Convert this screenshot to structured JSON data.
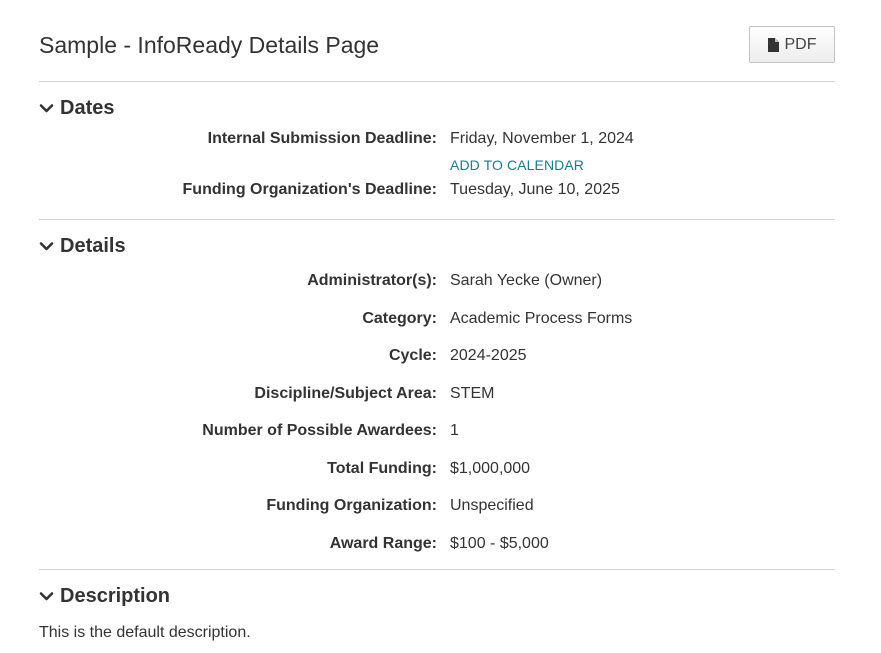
{
  "page": {
    "title": "Sample - InfoReady Details Page",
    "pdf_label": "PDF"
  },
  "dates": {
    "heading": "Dates",
    "internal_deadline_label": "Internal Submission Deadline:",
    "internal_deadline_value": "Friday, November 1, 2024",
    "add_to_calendar": "ADD TO CALENDAR",
    "funding_deadline_label": "Funding Organization's Deadline:",
    "funding_deadline_value": "Tuesday, June 10, 2025"
  },
  "details": {
    "heading": "Details",
    "rows": [
      {
        "label": "Administrator(s):",
        "value": "Sarah Yecke (Owner)"
      },
      {
        "label": "Category:",
        "value": "Academic Process Forms"
      },
      {
        "label": "Cycle:",
        "value": "2024-2025"
      },
      {
        "label": "Discipline/Subject Area:",
        "value": "STEM"
      },
      {
        "label": "Number of Possible Awardees:",
        "value": "1"
      },
      {
        "label": "Total Funding:",
        "value": "$1,000,000"
      },
      {
        "label": "Funding Organization:",
        "value": "Unspecified"
      },
      {
        "label": "Award Range:",
        "value": "$100 - $5,000"
      }
    ]
  },
  "description": {
    "heading": "Description",
    "text": "This is the default description."
  },
  "colors": {
    "link": "#1e7a8c",
    "text": "#333333",
    "divider": "#d3d3d3"
  },
  "icons": {
    "pdf": "file-icon",
    "section_toggle": "chevron-down-icon"
  }
}
